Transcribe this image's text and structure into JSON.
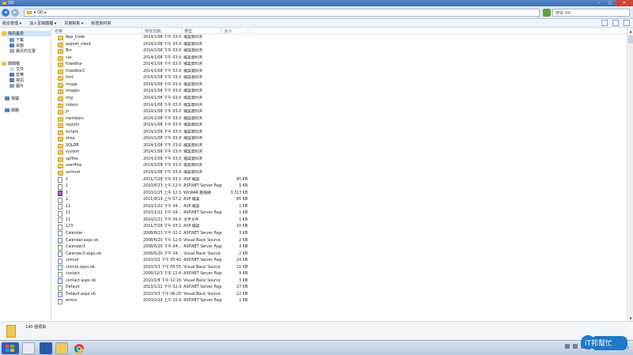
{
  "window": {
    "title": "OD"
  },
  "address": {
    "path": "▸ OD ▸",
    "search_placeholder": "搜尋 OD"
  },
  "toolbar": {
    "organize": "組合管理  ▾",
    "include_library": "加入至媒體櫃  ▾",
    "share": "共用對象  ▾",
    "new_folder": "新增資料夾"
  },
  "nav": {
    "favorites": "我的最愛",
    "downloads": "下載",
    "desktop": "桌面",
    "recent": "最近的位置",
    "libraries": "媒體櫃",
    "documents": "文件",
    "music": "音樂",
    "videos": "視訊",
    "pictures": "圖片",
    "computer": "電腦",
    "network": "網路"
  },
  "columns": {
    "name": "名稱",
    "date": "修改日期",
    "type": "類型",
    "size": "大小"
  },
  "files": [
    {
      "name": "App_Code",
      "date": "2014/1/08 下午 03:08",
      "type": "檔案資料夾",
      "size": "",
      "icon": "folder"
    },
    {
      "name": "aspnet_client",
      "date": "2014/1/08 下午 03:08",
      "type": "檔案資料夾",
      "size": "",
      "icon": "folder"
    },
    {
      "name": "Bin",
      "date": "2014/1/08 下午 03:08",
      "type": "檔案資料夾",
      "size": "",
      "icon": "folder"
    },
    {
      "name": "css",
      "date": "2014/1/08 下午 03:08",
      "type": "檔案資料夾",
      "size": "",
      "icon": "folder"
    },
    {
      "name": "fckeditor",
      "date": "2014/1/08 下午 03:08",
      "type": "檔案資料夾",
      "size": "",
      "icon": "folder"
    },
    {
      "name": "fckeditor2",
      "date": "2014/1/08 下午 03:08",
      "type": "檔案資料夾",
      "size": "",
      "icon": "folder"
    },
    {
      "name": "font",
      "date": "2014/1/08 下午 03:08",
      "type": "檔案資料夾",
      "size": "",
      "icon": "folder"
    },
    {
      "name": "image",
      "date": "2014/1/08 下午 03:08",
      "type": "檔案資料夾",
      "size": "",
      "icon": "folder"
    },
    {
      "name": "images",
      "date": "2014/1/08 下午 03:08",
      "type": "檔案資料夾",
      "size": "",
      "icon": "folder"
    },
    {
      "name": "img",
      "date": "2014/1/08 下午 03:08",
      "type": "檔案資料夾",
      "size": "",
      "icon": "folder"
    },
    {
      "name": "indexs",
      "date": "2014/1/08 下午 03:08",
      "type": "檔案資料夾",
      "size": "",
      "icon": "folder"
    },
    {
      "name": "js",
      "date": "2014/1/08 下午 03:08",
      "type": "檔案資料夾",
      "size": "",
      "icon": "folder"
    },
    {
      "name": "members",
      "date": "2014/1/08 下午 03:08",
      "type": "檔案資料夾",
      "size": "",
      "icon": "folder"
    },
    {
      "name": "reports",
      "date": "2014/1/08 下午 03:08",
      "type": "檔案資料夾",
      "size": "",
      "icon": "folder"
    },
    {
      "name": "scripts",
      "date": "2014/1/08 下午 03:08",
      "type": "檔案資料夾",
      "size": "",
      "icon": "folder"
    },
    {
      "name": "shop",
      "date": "2014/1/08 下午 03:08",
      "type": "檔案資料夾",
      "size": "",
      "icon": "folder"
    },
    {
      "name": "SQLDB",
      "date": "2014/1/08 下午 03:08",
      "type": "檔案資料夾",
      "size": "",
      "icon": "folder"
    },
    {
      "name": "system",
      "date": "2014/1/08 下午 03:08",
      "type": "檔案資料夾",
      "size": "",
      "icon": "folder"
    },
    {
      "name": "upfiles",
      "date": "2014/1/08 下午 03:09",
      "type": "檔案資料夾",
      "size": "",
      "icon": "folder"
    },
    {
      "name": "userfiles",
      "date": "2014/1/08 下午 03:09",
      "type": "檔案資料夾",
      "size": "",
      "icon": "folder"
    },
    {
      "name": "usrmod",
      "date": "2014/1/08 下午 03:09",
      "type": "檔案資料夾",
      "size": "",
      "icon": "folder"
    },
    {
      "name": "1",
      "date": "2011/7/28 下午 03:10",
      "type": "ASP 檔案",
      "size": "85 KB",
      "icon": "file"
    },
    {
      "name": "1",
      "date": "2010/6/23 上午 12:54",
      "type": "ASP.NET Server Page",
      "size": "1 KB",
      "icon": "file"
    },
    {
      "name": "1",
      "date": "2010/2/25 上午 12:16",
      "type": "WinRAR 壓縮檔",
      "size": "3,313 KB",
      "icon": "rar"
    },
    {
      "name": "2",
      "date": "2011/9/19 上午 07:28",
      "type": "ASP 檔案",
      "size": "85 KB",
      "icon": "file"
    },
    {
      "name": "11",
      "date": "2010/1/22 下午 04:...",
      "type": "ASP 檔案",
      "size": "1 KB",
      "icon": "file"
    },
    {
      "name": "11",
      "date": "2010/1/22 下午 04:...",
      "type": "ASP.NET Server Page",
      "size": "1 KB",
      "icon": "file"
    },
    {
      "name": "11",
      "date": "2014/1/21 下午 09:07",
      "type": "文字文件",
      "size": "1 KB",
      "icon": "file"
    },
    {
      "name": "123",
      "date": "2011/7/28 下午 03:10",
      "type": "ASP 檔案",
      "size": "10 KB",
      "icon": "file"
    },
    {
      "name": "Calendar",
      "date": "2008/6/21 下午 02:23",
      "type": "ASP.NET Server Page",
      "size": "3 KB",
      "icon": "file"
    },
    {
      "name": "Calendar.aspx.vb",
      "date": "2008/6/20 下午 12:06",
      "type": "Visual Basic Source ...",
      "size": "2 KB",
      "icon": "vb"
    },
    {
      "name": "Calendar3",
      "date": "2008/6/20 下午 04:...",
      "type": "ASP.NET Server Page",
      "size": "3 KB",
      "icon": "file"
    },
    {
      "name": "Calendar3.aspx.vb",
      "date": "2008/6/20 下午 04:...",
      "type": "Visual Basic Source ...",
      "size": "2 KB",
      "icon": "vb"
    },
    {
      "name": "chmod",
      "date": "2010/3/2 下午 05:42",
      "type": "ASP.NET Server Page",
      "size": "24 KB",
      "icon": "file"
    },
    {
      "name": "chmod.aspx.vb",
      "date": "2010/3/3 下午 05:55",
      "type": "Visual Basic Source ...",
      "size": "21 KB",
      "icon": "vb"
    },
    {
      "name": "contact",
      "date": "2008/12/3 下午 11:40",
      "type": "ASP.NET Server Page",
      "size": "9 KB",
      "icon": "file"
    },
    {
      "name": "contact.aspx.vb",
      "date": "2010/2/8 下午 12:16",
      "type": "Visual Basic Source ...",
      "size": "3 KB",
      "icon": "vb"
    },
    {
      "name": "Default",
      "date": "2013/1/12 下午 02:39",
      "type": "ASP.NET Server Page",
      "size": "27 KB",
      "icon": "file"
    },
    {
      "name": "Default.aspx.vb",
      "date": "2010/3/3 下午 06:20",
      "type": "Visual Basic Source ...",
      "size": "12 KB",
      "icon": "vb"
    },
    {
      "name": "errors",
      "date": "2010/2/24 上午 10:47",
      "type": "ASP.NET Server Page",
      "size": "1 KB",
      "icon": "file"
    }
  ],
  "details": {
    "item_count": "140 個項目"
  },
  "taskbar": {
    "clock": "2014/1/27"
  },
  "watermark": {
    "text": "iT邦幫忙"
  }
}
